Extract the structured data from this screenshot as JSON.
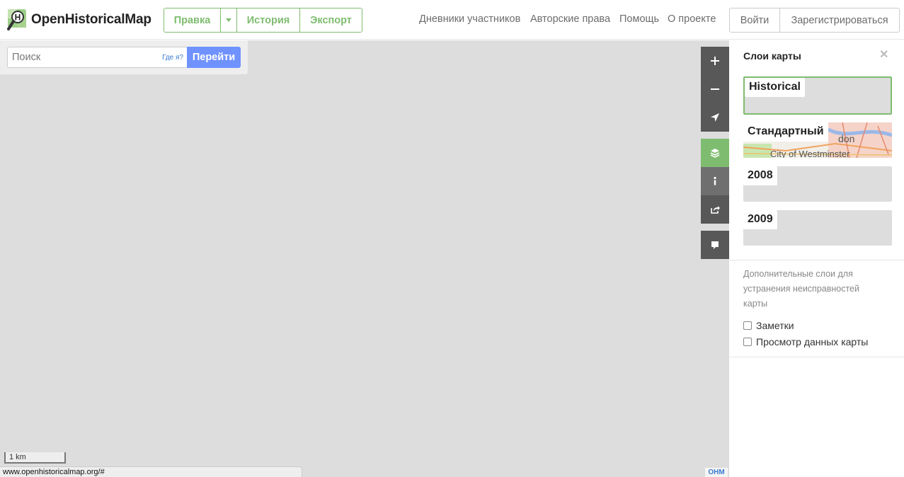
{
  "header": {
    "brand": "OpenHistoricalMap",
    "edit_label": "Правка",
    "history_label": "История",
    "export_label": "Экспорт",
    "nav": [
      "Дневники участников",
      "Авторские права",
      "Помощь",
      "О проекте"
    ],
    "login_label": "Войти",
    "signup_label": "Зарегистрироваться"
  },
  "search": {
    "placeholder": "Поиск",
    "where_am_i": "Где я?",
    "go_label": "Перейти"
  },
  "map": {
    "background_color": "#dddddd",
    "scale_label": "1 km",
    "status_url": "www.openhistoricalmap.org/#",
    "badge": "OHM"
  },
  "controls": [
    "zoom-in-icon",
    "zoom-out-icon",
    "locate-icon",
    "layers-icon",
    "info-icon",
    "share-icon",
    "note-icon"
  ],
  "sidebar": {
    "title": "Слои карты",
    "layers": [
      {
        "label": "Historical",
        "selected": true
      },
      {
        "label": "Стандартный",
        "selected": false
      },
      {
        "label": "2008",
        "selected": false
      },
      {
        "label": "2009",
        "selected": false
      }
    ],
    "thumbnail_caption": "City of Westminster",
    "thumbnail_fragment": "don",
    "overlay_note": "Дополнительные слои для устранения неисправностей карты",
    "overlays": [
      "Заметки",
      "Просмотр данных карты"
    ]
  },
  "colors": {
    "brand_green": "#7ebc6f",
    "go_blue": "#7092ff",
    "control_dark": "#585858"
  }
}
